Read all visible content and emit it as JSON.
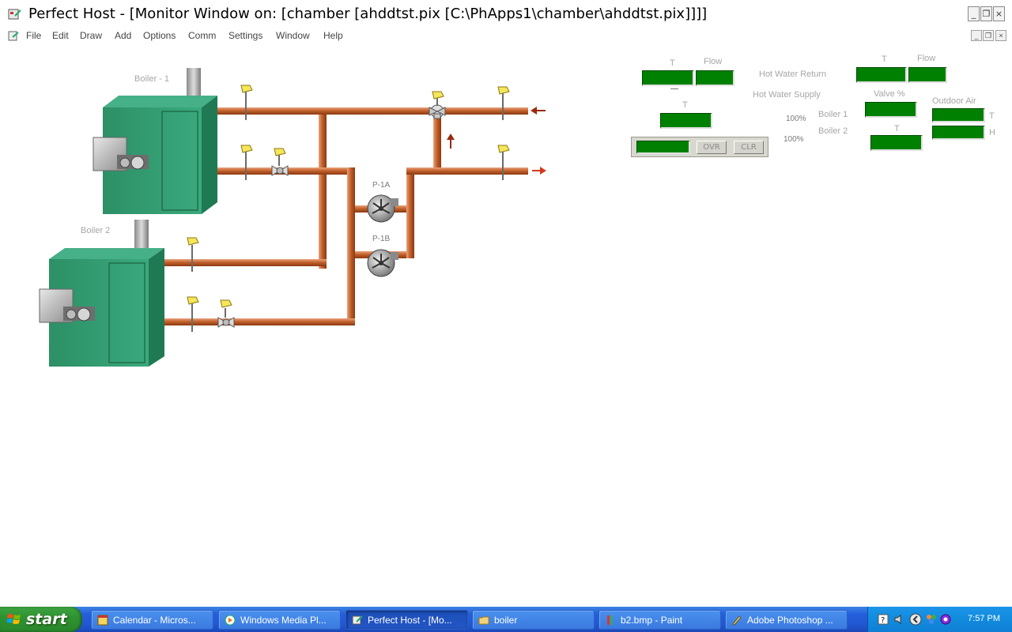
{
  "window": {
    "title": "Perfect Host - [Monitor Window on: [chamber [ahddtst.pix [C:\\PhApps1\\chamber\\ahddtst.pix]]]]",
    "buttons": {
      "minimize": "_",
      "restore": "❐",
      "close": "×"
    }
  },
  "menu": {
    "items": [
      "File",
      "Edit",
      "Draw",
      "Add",
      "Options",
      "Comm",
      "Settings",
      "Window",
      "Help"
    ]
  },
  "diagram": {
    "boiler1_label": "Boiler - 1",
    "boiler2_label": "Boiler 2",
    "pump_a_label": "P-1A",
    "pump_b_label": "P-1B"
  },
  "panel": {
    "return_t": "T",
    "return_flow": "Flow",
    "supply_t": "T",
    "hot_water_return": "Hot Water Return",
    "right_t": "T",
    "right_flow": "Flow",
    "hot_water_supply": "Hot Water Supply",
    "valve_pct": "Valve %",
    "outdoor_air": "Outdoor Air",
    "boiler_1": "Boiler 1",
    "boiler_2": "Boiler 2",
    "bottom_t": "T",
    "oa_t": "T",
    "oa_h": "H",
    "status_1": "100%",
    "status_2": "100%",
    "ovr_button": "OVR",
    "clr_button": "CLR"
  },
  "colors": {
    "pipe": "#c4612c",
    "boiler": "#2f9a6e",
    "value_box": "#008000",
    "arrow": "#9a2a10"
  },
  "taskbar": {
    "start_label": "start",
    "tasks": [
      {
        "label": "Calendar - Micros...",
        "icon": "calendar-icon"
      },
      {
        "label": "Windows Media Pl...",
        "icon": "media-player-icon"
      },
      {
        "label": "Perfect Host - [Mo...",
        "icon": "perfect-host-icon",
        "active": true
      },
      {
        "label": "boiler",
        "icon": "folder-icon"
      },
      {
        "label": "b2.bmp - Paint",
        "icon": "paint-icon"
      },
      {
        "label": "Adobe Photoshop ...",
        "icon": "photoshop-icon"
      }
    ],
    "clock": "7:57 PM"
  }
}
